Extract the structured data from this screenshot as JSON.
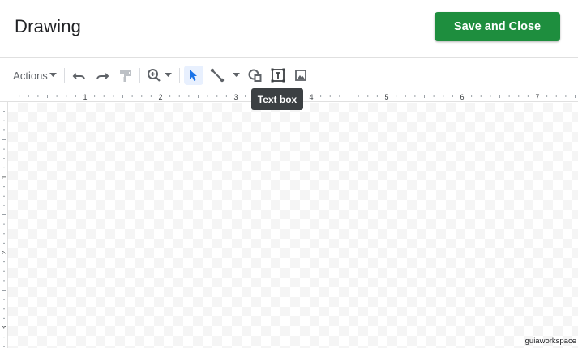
{
  "header": {
    "title": "Drawing",
    "save_label": "Save and Close"
  },
  "toolbar": {
    "actions_label": "Actions",
    "tooltip": "Text box"
  },
  "ruler": {
    "top_numbers": [
      "1",
      "2",
      "3",
      "4",
      "5",
      "6",
      "7"
    ],
    "left_numbers": [
      "1",
      "2",
      "3"
    ]
  },
  "watermark": "guiaworkspace",
  "colors": {
    "save_button": "#1e8e3e",
    "select_active": "#1a73e8",
    "icon": "#5f6368",
    "tooltip_bg": "#3c4043"
  }
}
